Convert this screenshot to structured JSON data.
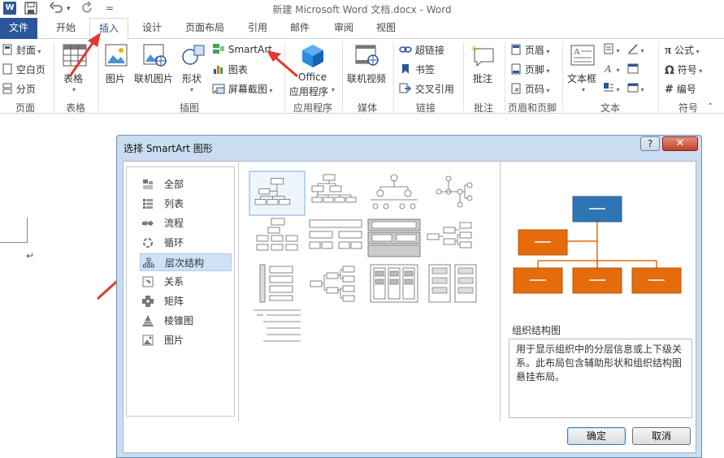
{
  "window": {
    "title": "新建 Microsoft Word 文档.docx - Word",
    "logo_letter": "W"
  },
  "quick_access": {
    "save_icon": "save-icon",
    "undo_icon": "undo-icon",
    "redo_icon": "redo-icon"
  },
  "ribbon_tabs": [
    "文件",
    "开始",
    "插入",
    "设计",
    "页面布局",
    "引用",
    "邮件",
    "审阅",
    "视图"
  ],
  "ribbon": {
    "pages": {
      "cover": "封面",
      "blank": "空白页",
      "break": "分页",
      "label": "页面"
    },
    "tables": {
      "table": "表格",
      "label": "表格"
    },
    "illustrations": {
      "picture": "图片",
      "online_picture": "联机图片",
      "shapes": "形状",
      "smartart": "SmartArt",
      "chart": "图表",
      "screenshot": "屏幕截图",
      "label": "插图"
    },
    "apps": {
      "office_line1": "Office",
      "office_line2": "应用程序",
      "label": "应用程序"
    },
    "media": {
      "online_video": "联机视频",
      "label": "媒体"
    },
    "links": {
      "hyperlink": "超链接",
      "bookmark": "书签",
      "cross_ref": "交叉引用",
      "label": "链接"
    },
    "comments": {
      "comment": "批注",
      "label": "批注"
    },
    "header_footer": {
      "header": "页眉",
      "footer": "页脚",
      "page_number": "页码",
      "label": "页眉和页脚"
    },
    "text": {
      "textbox": "文本框",
      "label": "文本"
    },
    "symbols": {
      "equation": "公式",
      "symbol": "符号",
      "numbering": "编号",
      "label": "符号",
      "pi": "π",
      "omega": "Ω",
      "hash": "#"
    }
  },
  "dialog": {
    "title": "选择 SmartArt 图形",
    "help": "?",
    "close": "✕",
    "categories": [
      {
        "label": "全部",
        "icon": "all-icon"
      },
      {
        "label": "列表",
        "icon": "list-icon"
      },
      {
        "label": "流程",
        "icon": "process-icon"
      },
      {
        "label": "循环",
        "icon": "cycle-icon"
      },
      {
        "label": "层次结构",
        "icon": "hierarchy-icon",
        "selected": true
      },
      {
        "label": "关系",
        "icon": "relationship-icon"
      },
      {
        "label": "矩阵",
        "icon": "matrix-icon"
      },
      {
        "label": "棱锥图",
        "icon": "pyramid-icon"
      },
      {
        "label": "图片",
        "icon": "picture-icon"
      }
    ],
    "preview": {
      "name": "组织结构图",
      "description": "用于显示组织中的分层信息或上下级关系。此布局包含辅助形状和组织结构图悬挂布局。",
      "top_color": "#2e75b6",
      "child_color": "#e46c0a"
    },
    "ok": "确定",
    "cancel": "取消"
  },
  "colors": {
    "accent": "#2b579a",
    "arrow": "#e03a2f"
  }
}
